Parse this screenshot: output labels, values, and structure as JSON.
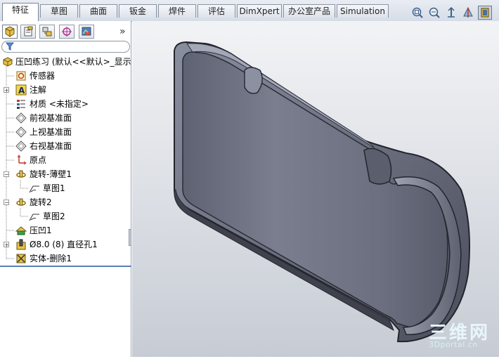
{
  "command_tabs": [
    {
      "label": "特征",
      "active": true
    },
    {
      "label": "草图"
    },
    {
      "label": "曲面"
    },
    {
      "label": "钣金"
    },
    {
      "label": "焊件"
    },
    {
      "label": "评估"
    },
    {
      "label": "DimXpert"
    },
    {
      "label": "办公室产品"
    },
    {
      "label": "Simulation"
    }
  ],
  "view_tools": [
    "zoom-to-fit-icon",
    "zoom-to-area-icon",
    "previous-view-icon",
    "section-view-icon"
  ],
  "panel_tabs": [
    "feature-manager-icon",
    "property-manager-icon",
    "configuration-manager-icon",
    "dimxpert-manager-icon",
    "display-manager-icon"
  ],
  "panel_more": "»",
  "feature_tree": [
    {
      "label": "压凹练习  (默认<<默认>_显示",
      "icon": "part-icon"
    },
    {
      "label": "传感器",
      "icon": "sensor-icon"
    },
    {
      "label": "注解",
      "icon": "annotations-icon"
    },
    {
      "label": "材质 <未指定>",
      "icon": "material-icon"
    },
    {
      "label": "前视基准面",
      "icon": "plane-icon"
    },
    {
      "label": "上视基准面",
      "icon": "plane-icon"
    },
    {
      "label": "右视基准面",
      "icon": "plane-icon"
    },
    {
      "label": "原点",
      "icon": "origin-icon"
    },
    {
      "label": "旋转-薄壁1",
      "icon": "revolve-icon"
    },
    {
      "label": "草图1",
      "icon": "sketch-icon"
    },
    {
      "label": "旋转2",
      "icon": "revolve-icon"
    },
    {
      "label": "草图2",
      "icon": "sketch-icon"
    },
    {
      "label": "压凹1",
      "icon": "indent-icon"
    },
    {
      "label": "Ø8.0 (8) 直径孔1",
      "icon": "hole-icon"
    },
    {
      "label": "实体-删除1",
      "icon": "delete-body-icon"
    }
  ],
  "watermark": {
    "main": "三维网",
    "sub": "3Dportal.cn"
  },
  "colors": {
    "model_body": "#6b6f80",
    "model_edge": "#2a2c36",
    "viewport_top": "#f2f3f5",
    "tree_bar": "#5a7fb5"
  }
}
